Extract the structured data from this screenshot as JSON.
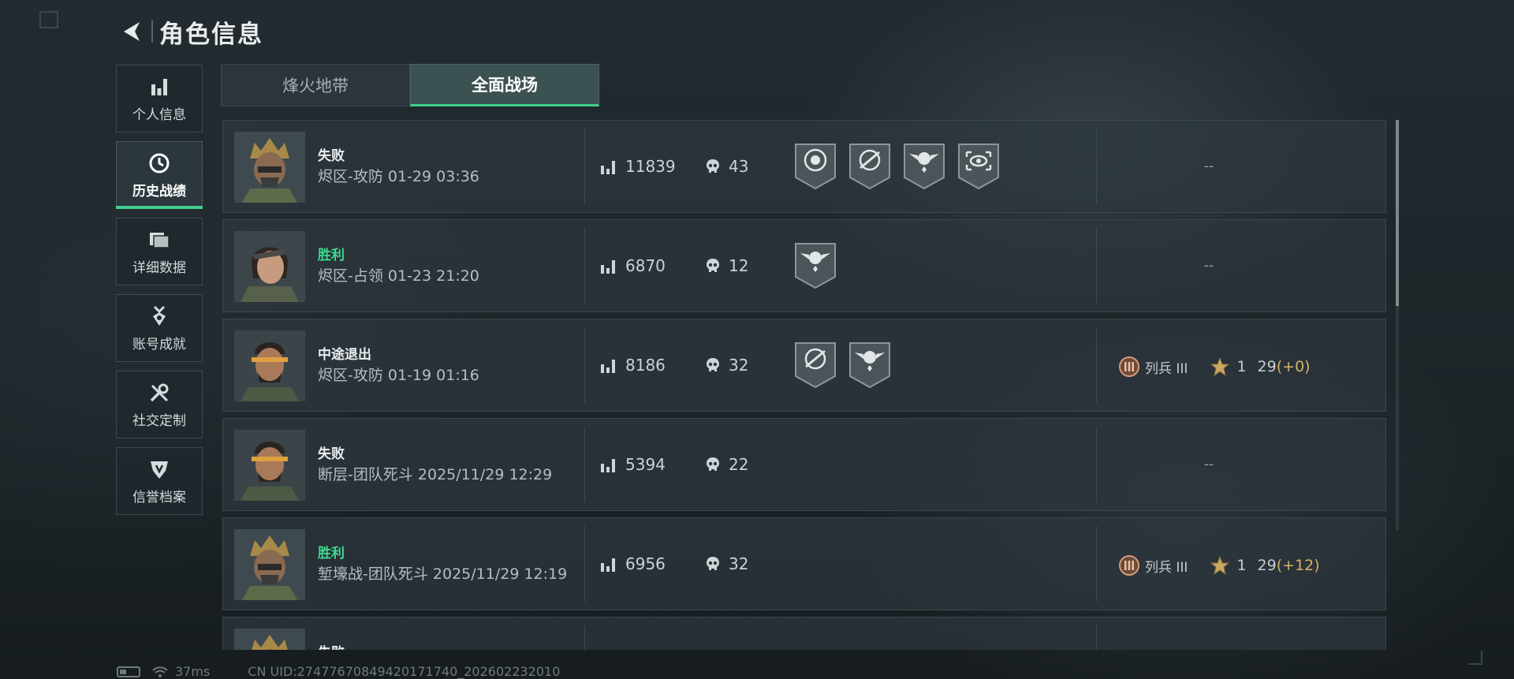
{
  "header": {
    "title": "角色信息"
  },
  "sidebar": {
    "items": [
      {
        "label": "个人信息",
        "icon": "bar-chart-icon"
      },
      {
        "label": "历史战绩",
        "icon": "clock-icon",
        "active": true
      },
      {
        "label": "详细数据",
        "icon": "folder-icon"
      },
      {
        "label": "账号成就",
        "icon": "medal-icon"
      },
      {
        "label": "社交定制",
        "icon": "tools-icon"
      },
      {
        "label": "信誉档案",
        "icon": "shield-icon"
      }
    ]
  },
  "tabs": [
    {
      "label": "烽火地带",
      "active": false
    },
    {
      "label": "全面战场",
      "active": true
    }
  ],
  "matches": [
    {
      "result": "失败",
      "win": false,
      "mode": "烬区-攻防 01-29 03:36",
      "score": "11839",
      "kills": "43",
      "badges": [
        "skull-target-badge",
        "crosshair-rifle-badge",
        "skull-wings-badge",
        "eye-scope-badge"
      ],
      "rank": null,
      "dash": "--"
    },
    {
      "result": "胜利",
      "win": true,
      "mode": "烬区-占领 01-23 21:20",
      "score": "6870",
      "kills": "12",
      "badges": [
        "skull-wings-badge"
      ],
      "rank": null,
      "dash": "--"
    },
    {
      "result": "中途退出",
      "win": false,
      "mode": "烬区-攻防 01-19 01:16",
      "score": "8186",
      "kills": "32",
      "badges": [
        "crosshair-rifle-badge",
        "skull-wings-badge"
      ],
      "rank": {
        "name": "列兵 III",
        "level": "1",
        "points": "29",
        "delta": "(+0)"
      },
      "dash": ""
    },
    {
      "result": "失败",
      "win": false,
      "mode": "断层-团队死斗 2025/11/29 12:29",
      "score": "5394",
      "kills": "22",
      "badges": [],
      "rank": null,
      "dash": "--"
    },
    {
      "result": "胜利",
      "win": true,
      "mode": "堑壕战-团队死斗 2025/11/29 12:19",
      "score": "6956",
      "kills": "32",
      "badges": [],
      "rank": {
        "name": "列兵 III",
        "level": "1",
        "points": "29",
        "delta": "(+12)"
      },
      "dash": ""
    },
    {
      "result": "失败",
      "win": false,
      "mode": "",
      "score": "",
      "kills": "",
      "badges": [],
      "rank": null,
      "dash": ""
    }
  ],
  "status_bar": {
    "ping": "37ms",
    "uid": "CN UID:2747767084942017174​0_202602232010"
  },
  "colors": {
    "accent": "#3fcf8e",
    "win": "#3fd98e",
    "delta": "#d6b36a"
  }
}
